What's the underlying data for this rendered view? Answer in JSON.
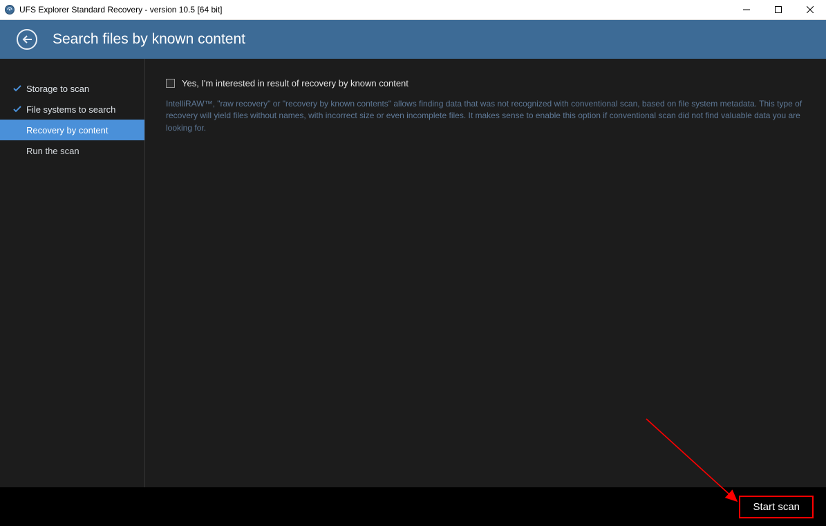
{
  "window": {
    "title": "UFS Explorer Standard Recovery - version 10.5 [64 bit]"
  },
  "header": {
    "title": "Search files by known content"
  },
  "sidebar": {
    "items": [
      {
        "label": "Storage to scan",
        "state": "completed"
      },
      {
        "label": "File systems to search",
        "state": "completed"
      },
      {
        "label": "Recovery by content",
        "state": "active"
      },
      {
        "label": "Run the scan",
        "state": "pending"
      }
    ]
  },
  "content": {
    "checkbox_label": "Yes, I'm interested in result of recovery by known content",
    "description": "IntelliRAW™, \"raw recovery\" or \"recovery by known contents\" allows finding data that was not recognized with conventional scan, based on file system metadata. This type of recovery will yield files without names, with incorrect size or even incomplete files. It makes sense to enable this option if conventional scan did not find valuable data you are looking for."
  },
  "footer": {
    "start_scan_label": "Start scan"
  }
}
